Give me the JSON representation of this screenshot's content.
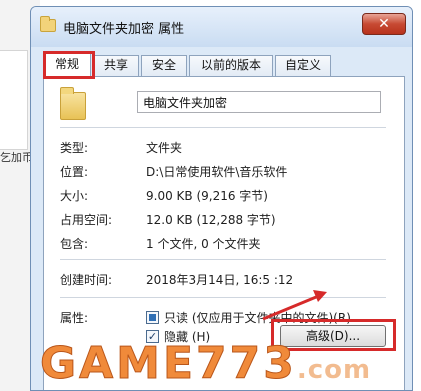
{
  "background": {
    "partial_label": "乞加币"
  },
  "dialog": {
    "title": "电脑文件夹加密 属性",
    "close_glyph": "✕",
    "tabs": [
      {
        "label": "常规",
        "active": true
      },
      {
        "label": "共享",
        "active": false
      },
      {
        "label": "安全",
        "active": false
      },
      {
        "label": "以前的版本",
        "active": false
      },
      {
        "label": "自定义",
        "active": false
      }
    ],
    "folder_name": "电脑文件夹加密",
    "properties": {
      "type": {
        "label": "类型:",
        "value": "文件夹"
      },
      "location": {
        "label": "位置:",
        "value": "D:\\日常使用软件\\音乐软件"
      },
      "size": {
        "label": "大小:",
        "value": "9.00 KB (9,216 字节)"
      },
      "size_on_disk": {
        "label": "占用空间:",
        "value": "12.0 KB (12,288 字节)"
      },
      "contains": {
        "label": "包含:",
        "value": "1 个文件, 0 个文件夹"
      },
      "created": {
        "label": "创建时间:",
        "value": "2018年3月14日, 16:5 :12"
      }
    },
    "attributes": {
      "label": "属性:",
      "readonly": {
        "label": "只读 (仅应用于文件夹中的文件)(R)",
        "state": "indeterminate"
      },
      "hidden": {
        "label": "隐藏 (H)",
        "checked": true
      },
      "advanced_button": "高级(D)..."
    }
  },
  "highlight_color": "#d62a2a",
  "watermark": {
    "main": "GAME773",
    "sub": ".com"
  },
  "icons": [
    "folder-icon",
    "close-icon",
    "red-arrow"
  ]
}
